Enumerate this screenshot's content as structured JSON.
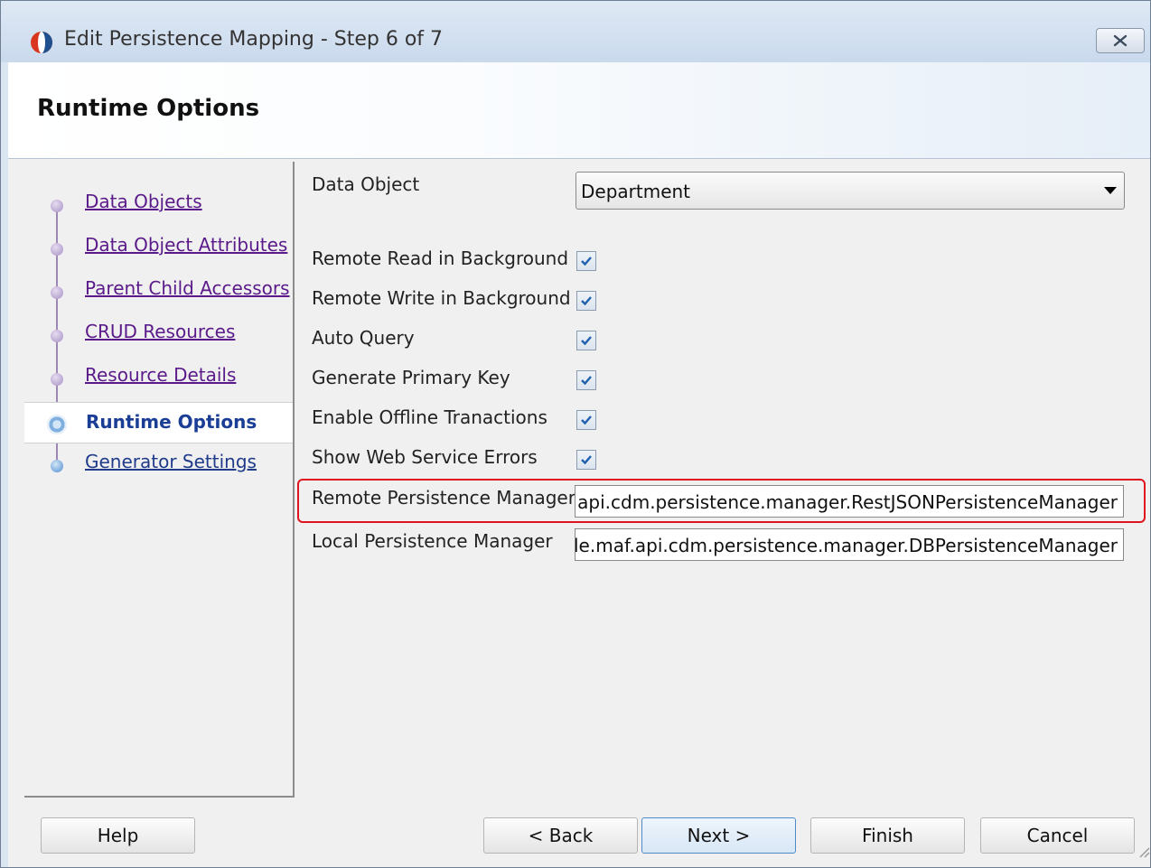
{
  "window": {
    "title": "Edit Persistence Mapping - Step 6 of 7",
    "close_icon": "close-icon"
  },
  "header": {
    "title": "Runtime Options"
  },
  "nav": {
    "items": [
      {
        "label": "Data Objects",
        "state": "visited"
      },
      {
        "label": "Data Object Attributes",
        "state": "visited"
      },
      {
        "label": "Parent Child Accessors",
        "state": "visited"
      },
      {
        "label": "CRUD Resources",
        "state": "visited"
      },
      {
        "label": "Resource Details",
        "state": "visited"
      },
      {
        "label": "Runtime Options",
        "state": "current"
      },
      {
        "label": "Generator Settings",
        "state": "upcoming"
      }
    ]
  },
  "form": {
    "data_object_label": "Data Object",
    "data_object_value": "Department",
    "options": [
      {
        "label": "Remote Read in Background",
        "checked": true
      },
      {
        "label": "Remote Write in Background",
        "checked": true
      },
      {
        "label": "Auto Query",
        "checked": true
      },
      {
        "label": "Generate Primary Key",
        "checked": true
      },
      {
        "label": "Enable Offline Tranactions",
        "checked": true
      },
      {
        "label": "Show Web Service Errors",
        "checked": true
      }
    ],
    "remote_pm_label": "Remote Persistence Manager",
    "remote_pm_value": "f.api.cdm.persistence.manager.RestJSONPersistenceManager",
    "local_pm_label": "Local Persistence Manager",
    "local_pm_value": "acle.maf.api.cdm.persistence.manager.DBPersistenceManager"
  },
  "buttons": {
    "help": "Help",
    "back": "< Back",
    "next": "Next >",
    "finish": "Finish",
    "cancel": "Cancel"
  },
  "colors": {
    "highlight": "#e0141e",
    "visited_link": "#5a1a8a",
    "current_step": "#1a3d96"
  }
}
